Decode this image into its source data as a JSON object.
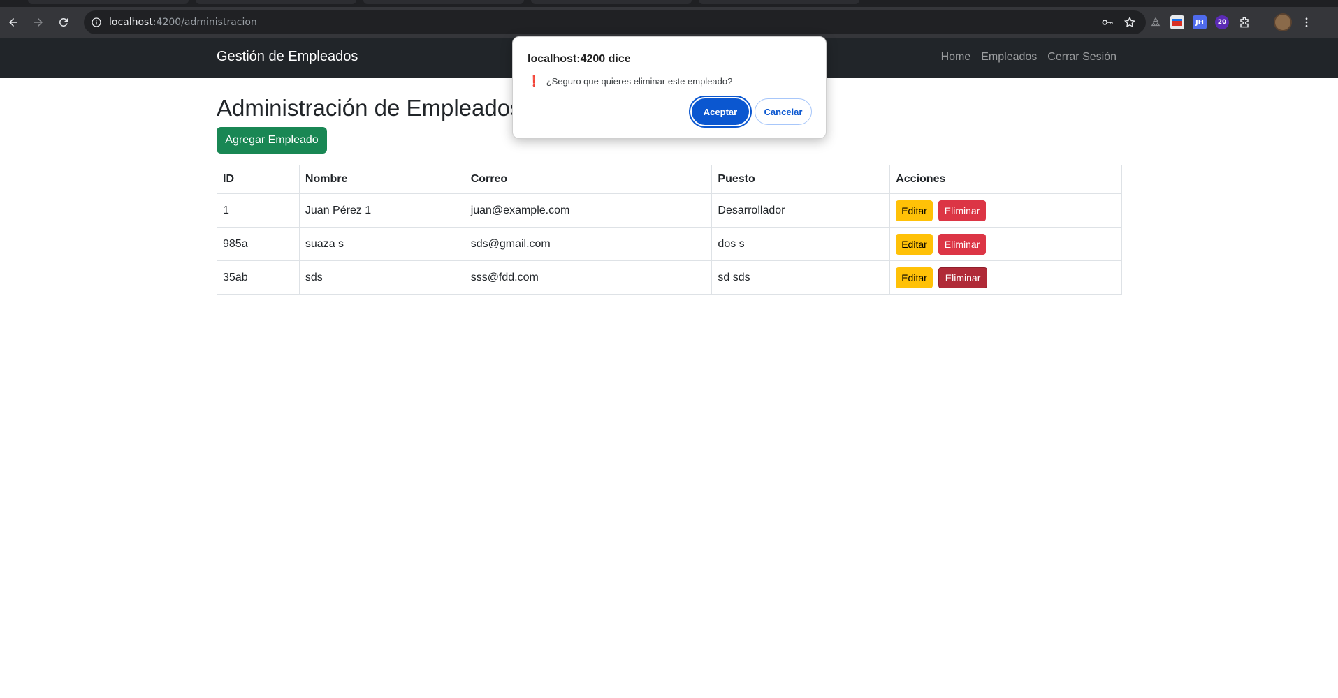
{
  "browser": {
    "url_host": "localhost",
    "url_path": ":4200/administracion",
    "extension_badge": "20",
    "extension_jh": "JH"
  },
  "navbar": {
    "brand": "Gestión de Empleados",
    "links": [
      "Home",
      "Empleados",
      "Cerrar Sesión"
    ]
  },
  "page": {
    "title": "Administración de Empleados",
    "add_button": "Agregar Empleado"
  },
  "table": {
    "headers": [
      "ID",
      "Nombre",
      "Correo",
      "Puesto",
      "Acciones"
    ],
    "rows": [
      {
        "id": "1",
        "nombre": "Juan Pérez 1",
        "correo": "juan@example.com",
        "puesto": "Desarrollador"
      },
      {
        "id": "985a",
        "nombre": "suaza s",
        "correo": "sds@gmail.com",
        "puesto": "dos s"
      },
      {
        "id": "35ab",
        "nombre": "sds",
        "correo": "sss@fdd.com",
        "puesto": "sd sds"
      }
    ],
    "edit_label": "Editar",
    "delete_label": "Eliminar"
  },
  "dialog": {
    "title": "localhost:4200 dice",
    "message": "¿Seguro que quieres eliminar este empleado?",
    "ok_label": "Aceptar",
    "cancel_label": "Cancelar"
  },
  "colors": {
    "navbar_bg": "#212529",
    "success": "#198754",
    "warning": "#ffc107",
    "danger": "#dc3545",
    "dialog_primary": "#0b57d0"
  }
}
